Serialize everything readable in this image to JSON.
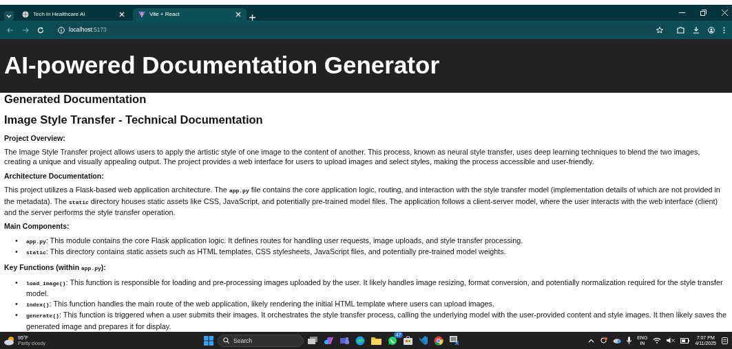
{
  "browser": {
    "tabs": [
      {
        "title": "Tech in Healthcare AI",
        "selected": false
      },
      {
        "title": "Vite + React",
        "selected": true
      }
    ],
    "address": {
      "host": "localhost",
      "port": ":5173"
    }
  },
  "page": {
    "title": "AI-powered Documentation Generator",
    "heading": "Generated Documentation",
    "doc_title": "Image Style Transfer - Technical Documentation",
    "blocks": [
      {
        "kind": "heading",
        "parts": [
          {
            "kind": "text",
            "text": "Project Overview:"
          }
        ]
      },
      {
        "kind": "paragraph",
        "parts": [
          {
            "kind": "text",
            "text": "The Image Style Transfer project allows users to apply the artistic style of one image to the content of another. This process, known as neural style transfer, uses deep learning techniques to blend the two images, creating a unique and visually appealing output. The project provides a web interface for users to upload images and select styles, making the process accessible and user-friendly."
          }
        ]
      },
      {
        "kind": "heading",
        "parts": [
          {
            "kind": "text",
            "text": "Architecture Documentation:"
          }
        ]
      },
      {
        "kind": "paragraph",
        "parts": [
          {
            "kind": "text",
            "text": "This project utilizes a Flask-based web application architecture. The "
          },
          {
            "kind": "code",
            "text": "app.py"
          },
          {
            "kind": "text",
            "text": " file contains the core application logic, routing, and interaction with the style transfer model (implementation details of which are not provided in the metadata). The "
          },
          {
            "kind": "code",
            "text": "static"
          },
          {
            "kind": "text",
            "text": " directory houses static assets like CSS, JavaScript, and potentially pre-trained model files. The application follows a client-server model, where the user interacts with the web interface (client) and the server performs the style transfer operation."
          }
        ]
      },
      {
        "kind": "heading",
        "parts": [
          {
            "kind": "text",
            "text": "Main Components:"
          }
        ]
      },
      {
        "kind": "list",
        "items": [
          {
            "marker": "•",
            "parts": [
              {
                "kind": "code",
                "text": "app.py"
              },
              {
                "kind": "text",
                "text": ": This module contains the core Flask application logic. It defines routes for handling user requests, image uploads, and style transfer processing."
              }
            ]
          },
          {
            "marker": "•",
            "parts": [
              {
                "kind": "code",
                "text": "static"
              },
              {
                "kind": "text",
                "text": ": This directory contains static assets such as HTML templates, CSS stylesheets, JavaScript files, and potentially pre-trained model weights."
              }
            ]
          }
        ]
      },
      {
        "kind": "heading",
        "parts": [
          {
            "kind": "text",
            "text": "Key Functions (within "
          },
          {
            "kind": "code",
            "text": "app.py"
          },
          {
            "kind": "text",
            "text": "):"
          }
        ]
      },
      {
        "kind": "list",
        "items": [
          {
            "marker": "•",
            "parts": [
              {
                "kind": "code",
                "text": "load_image()"
              },
              {
                "kind": "text",
                "text": ": This function is responsible for loading and pre-processing images uploaded by the user. It likely handles image resizing, format conversion, and potentially normalization required for the style transfer model."
              }
            ]
          },
          {
            "marker": "•",
            "parts": [
              {
                "kind": "code",
                "text": "index()"
              },
              {
                "kind": "text",
                "text": ": This function handles the main route of the web application, likely rendering the initial HTML template where users can upload images."
              }
            ]
          },
          {
            "marker": "•",
            "parts": [
              {
                "kind": "code",
                "text": "generate()"
              },
              {
                "kind": "text",
                "text": ": This function is triggered when a user submits their images. It orchestrates the style transfer process, calling the underlying model with the user-provided content and style images. It then likely saves the generated image and prepares it for display."
              }
            ]
          }
        ]
      }
    ]
  },
  "taskbar": {
    "weather": {
      "temperature": "95°F",
      "condition": "Partly cloudy"
    },
    "search": {
      "placeholder": "Search"
    },
    "chat_badge": "47",
    "language": {
      "code": "ENG",
      "region": "IN"
    },
    "time": "7:07 PM",
    "date": "4/11/2025"
  }
}
